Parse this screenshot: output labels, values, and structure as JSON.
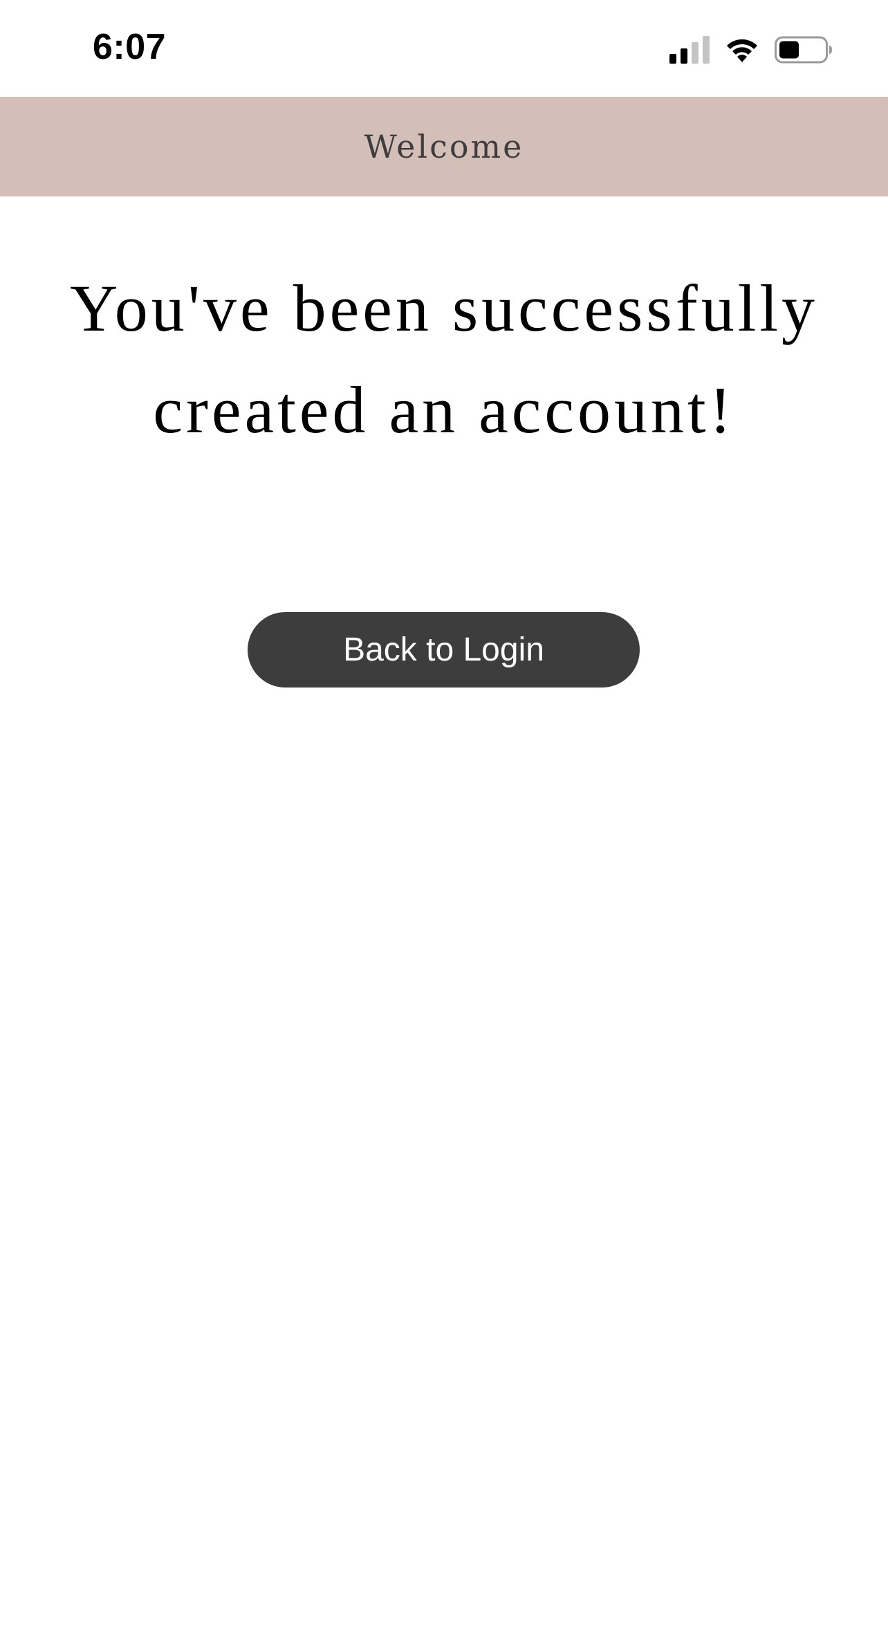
{
  "status_bar": {
    "time": "6:07",
    "icons": [
      "cellular-signal-icon",
      "wifi-icon",
      "battery-icon"
    ],
    "battery_level": 0.45
  },
  "header": {
    "title": "Welcome",
    "background_color": "#d3bfb8"
  },
  "main": {
    "message": "You've been successfully created an account!",
    "back_button_label": "Back to Login",
    "button_color": "#3d3d3d"
  }
}
